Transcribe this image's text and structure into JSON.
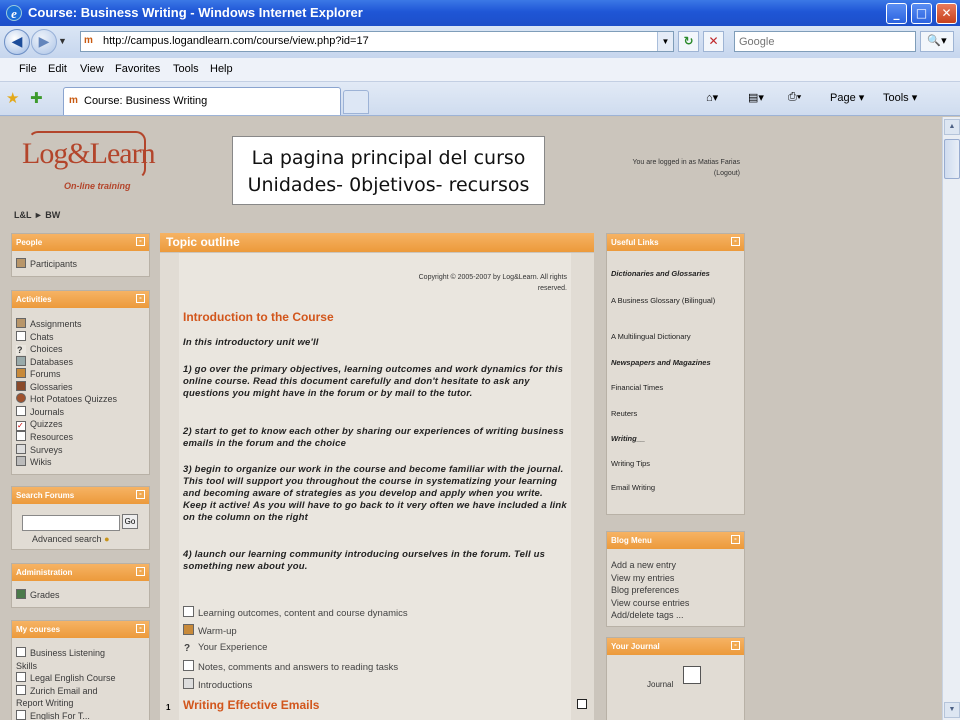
{
  "window": {
    "title": "Course: Business Writing - Windows Internet Explorer",
    "ie_glyph": "e",
    "controls": [
      "_",
      "□",
      "✕"
    ]
  },
  "address": {
    "url": "http://campus.logandlearn.com/course/view.php?id=17",
    "search_placeholder": "Google",
    "refresh_glyph": "↻",
    "stop_glyph": "✕",
    "go_glyph": "🔍▾"
  },
  "menu": [
    "File",
    "Edit",
    "View",
    "Favorites",
    "Tools",
    "Help"
  ],
  "tab": {
    "label": "Course: Business Writing",
    "favicon": "m"
  },
  "commands": {
    "home": "⌂▾",
    "feeds": "▤▾",
    "print": "⎙▾",
    "page": "Page ▾",
    "tools": "Tools ▾"
  },
  "site": {
    "logo_text": "Log&Learn",
    "logo_tagline": "On-line training",
    "login_text": "You are logged in as Matias Farias",
    "logout": "(Logout)",
    "breadcrumb": "L&L ► BW"
  },
  "overlay": {
    "line1": "La pagina principal del curso",
    "line2": "Unidades- 0bjetivos- recursos"
  },
  "left": {
    "people": {
      "title": "People",
      "items": [
        "Participants"
      ]
    },
    "activities": {
      "title": "Activities",
      "items": [
        "Assignments",
        "Chats",
        "Choices",
        "Databases",
        "Forums",
        "Glossaries",
        "Hot Potatoes Quizzes",
        "Journals",
        "Quizzes",
        "Resources",
        "Surveys",
        "Wikis"
      ]
    },
    "search": {
      "title": "Search Forums",
      "go": "Go",
      "advanced": "Advanced search"
    },
    "admin": {
      "title": "Administration",
      "items": [
        "Grades"
      ]
    },
    "mycourses": {
      "title": "My courses",
      "items": [
        "Business Listening",
        "Skills",
        "Legal English Course",
        "Zurich Email and",
        "Report Writing",
        "English For T..."
      ]
    }
  },
  "main": {
    "outline_title": "Topic outline",
    "copyright": "Copyright © 2005-2007 by Log&Learn. All rights reserved.",
    "intro_title": "Introduction to the Course",
    "intro_lead": "In this introductory unit we'll",
    "p1": "1) go over the primary objectives, learning outcomes and work dynamics for this online course. Read this document carefully and don't hesitate to ask any questions you might have in the forum or by mail to the tutor.",
    "p2": "2) start to get to know each other by sharing our experiences of writing business emails in the forum and the choice",
    "p3": "3) begin to organize our work in the course and become familiar with the journal. This tool will support you throughout the course in systematizing your learning and becoming aware of strategies as you develop and apply when you write. Keep it active! As you will have to go back to it very often we have included a link on the column on the right",
    "p4": "4) launch our learning community introducing ourselves in the forum. Tell us something new about you.",
    "resources": [
      "Learning outcomes, content and course dynamics",
      "Warm-up",
      "Your Experience",
      "Notes, comments and answers to reading tasks",
      "Introductions"
    ],
    "section2_number": "1",
    "section2_title": "Writing Effective Emails"
  },
  "right": {
    "links": {
      "title": "Useful Links",
      "items": [
        "Dictionaries and Glossaries",
        "A Business Glossary (Bilingual)",
        "A Multilingual Dictionary",
        "Newspapers and Magazines",
        "Financial Times",
        "Reuters",
        "Writing__",
        "Writing Tips",
        "Email Writing"
      ]
    },
    "blog": {
      "title": "Blog Menu",
      "items": [
        "Add a new entry",
        "View my entries",
        "Blog preferences",
        "View course entries",
        "Add/delete tags ..."
      ]
    },
    "journal": {
      "title": "Your Journal",
      "label": "Journal"
    }
  },
  "colors": {
    "accent_orange": "#ec9a3b",
    "heading_orange": "#d2561c",
    "brand": "#b3452b",
    "page_bg": "#cbc5bc"
  }
}
